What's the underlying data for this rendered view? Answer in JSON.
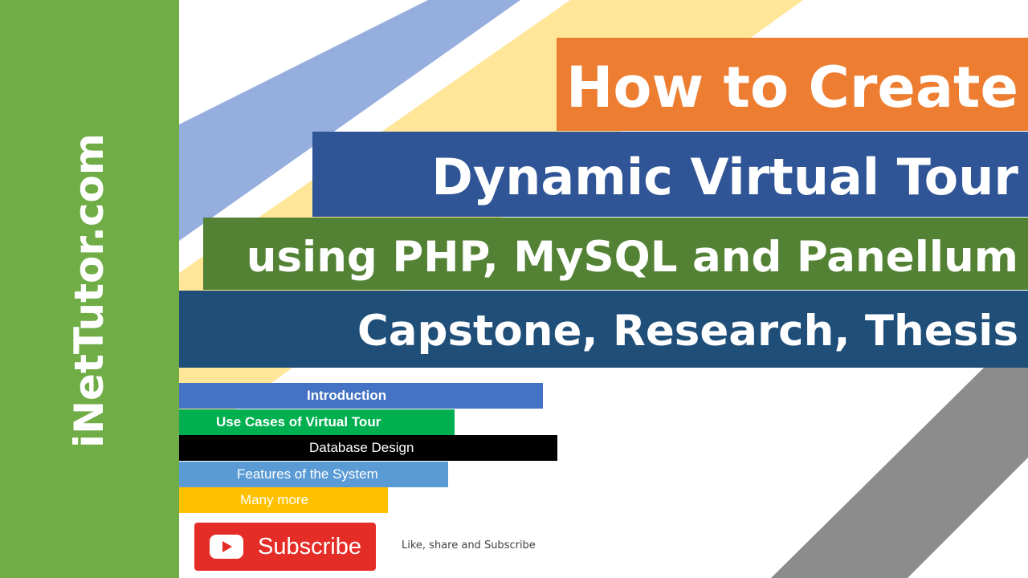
{
  "brand": {
    "name": "iNetTutor.com"
  },
  "title": {
    "line1": "How to Create",
    "line2": "Dynamic Virtual Tour",
    "line3": "using PHP, MySQL and Panellum",
    "line4": "Capstone, Research, Thesis"
  },
  "topics": [
    {
      "label": "Introduction"
    },
    {
      "label": "Use Cases of Virtual Tour"
    },
    {
      "label": "Database Design"
    },
    {
      "label": "Features of the System"
    },
    {
      "label": "Many more"
    }
  ],
  "subscribe": {
    "label": "Subscribe",
    "icon": "play-icon"
  },
  "caption": "Like, share and Subscribe",
  "colors": {
    "sidebar": "#70ad47",
    "orange": "#ed7d31",
    "blue": "#2f5597",
    "green": "#548235",
    "navy": "#1f4e79",
    "youtube_red": "#e52d27"
  }
}
